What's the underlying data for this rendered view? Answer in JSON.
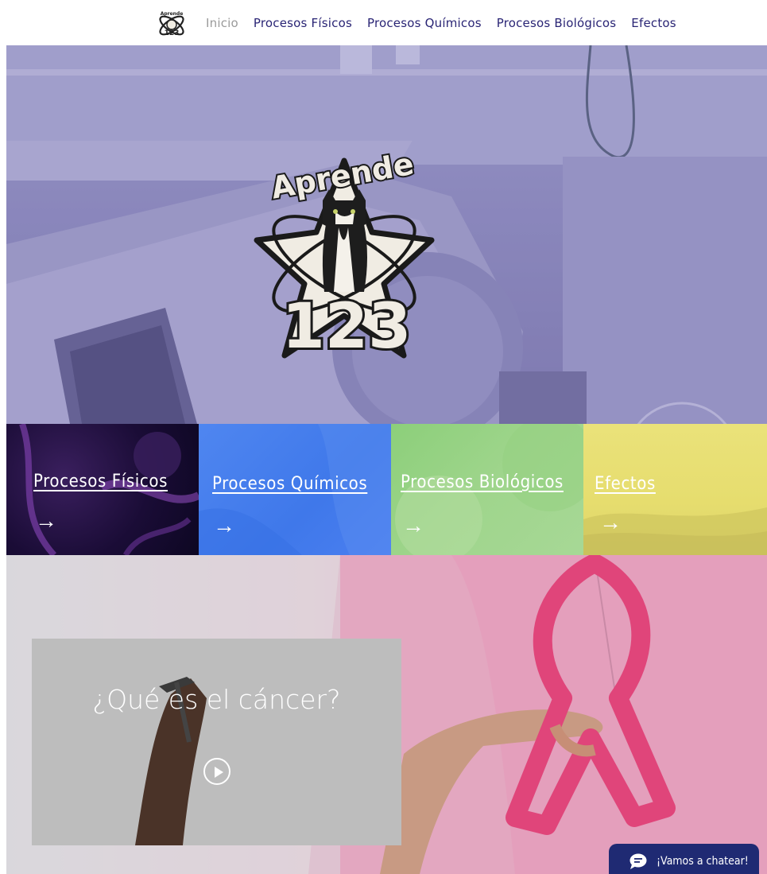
{
  "nav": {
    "logo_text": "Aprende 123",
    "items": [
      {
        "label": "Inicio",
        "active": true
      },
      {
        "label": "Procesos Físicos",
        "active": false
      },
      {
        "label": "Procesos Químicos",
        "active": false
      },
      {
        "label": "Procesos Biológicos",
        "active": false
      },
      {
        "label": "Efectos",
        "active": false
      }
    ]
  },
  "hero": {
    "logo_word": "Aprende",
    "logo_number": "123"
  },
  "tiles": [
    {
      "title": "Procesos Físicos",
      "arrow": "→",
      "color": "#1a0c36"
    },
    {
      "title": "Procesos Químicos",
      "arrow": "→",
      "color": "#4f86f0"
    },
    {
      "title": "Procesos Biológicos",
      "arrow": "→",
      "color": "#9fd58c"
    },
    {
      "title": "Efectos",
      "arrow": "→",
      "color": "#e6dd6e"
    }
  ],
  "video": {
    "title": "¿Qué es el cáncer?"
  },
  "chat": {
    "label": "¡Vamos a chatear!",
    "color": "#1f2a73"
  },
  "colors": {
    "nav_link": "#2a2575",
    "nav_active": "#9a9a9a",
    "ribbon": "#e0457a"
  }
}
